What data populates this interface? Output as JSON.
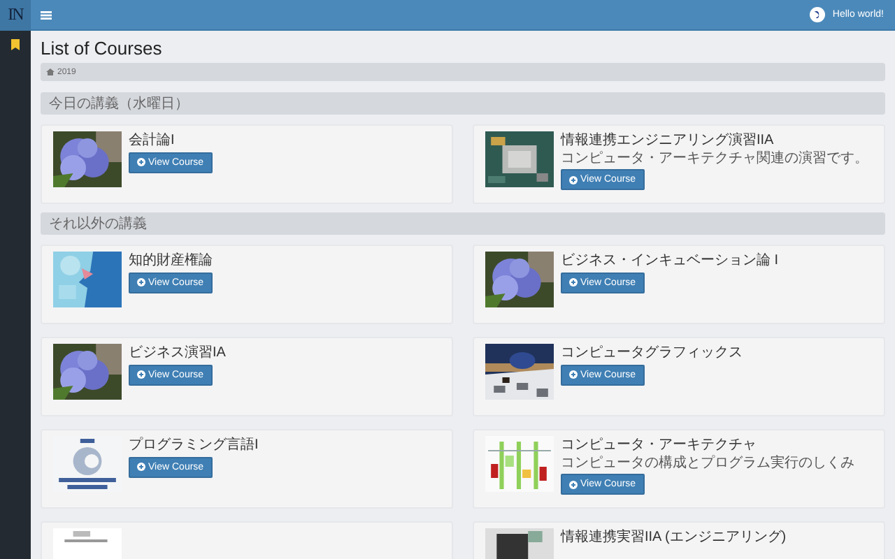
{
  "topbar": {
    "logo": "IN",
    "user": "Hello world!"
  },
  "sidebar": {
    "items": [
      {
        "kind": "bookmark",
        "selected": true
      }
    ]
  },
  "page": {
    "title": "List of Courses",
    "breadcrumb": "2019"
  },
  "sections": [
    {
      "heading": "今日の講義（水曜日）",
      "courses": [
        {
          "thumbnail": {
            "kind": "picture"
          },
          "title": "会計論I",
          "button": "View Course"
        },
        {
          "thumbnail": {
            "kind": "picture"
          },
          "title": "情報連携エンジニアリング演習IIA",
          "description": "コンピュータ・アーキテクチャ関連の演習です。",
          "button": "View Course"
        }
      ]
    },
    {
      "heading": "それ以外の講義",
      "courses": [
        {
          "thumbnail": {
            "kind": "picture"
          },
          "title": "知的財産権論",
          "button": "View Course"
        },
        {
          "thumbnail": {
            "kind": "picture"
          },
          "title": "ビジネス・インキュベーション論 I",
          "button": "View Course"
        },
        {
          "thumbnail": {
            "kind": "picture"
          },
          "title": "ビジネス演習IA",
          "button": "View Course"
        },
        {
          "thumbnail": {
            "kind": "picture"
          },
          "title": "コンピュータグラフィックス",
          "button": "View Course"
        },
        {
          "thumbnail": {
            "kind": "picture"
          },
          "title": "プログラミング言語I",
          "button": "View Course"
        },
        {
          "thumbnail": {
            "kind": "picture"
          },
          "title": "コンピュータ・アーキテクチャ",
          "description": "コンピュータの構成とプログラム実行のしくみ",
          "button": "View Course"
        },
        {
          "thumbnail": {
            "kind": "picture"
          }
        },
        {
          "thumbnail": {
            "kind": "picture"
          },
          "title": "情報連携実習IIA (エンジニアリング)"
        }
      ]
    }
  ]
}
